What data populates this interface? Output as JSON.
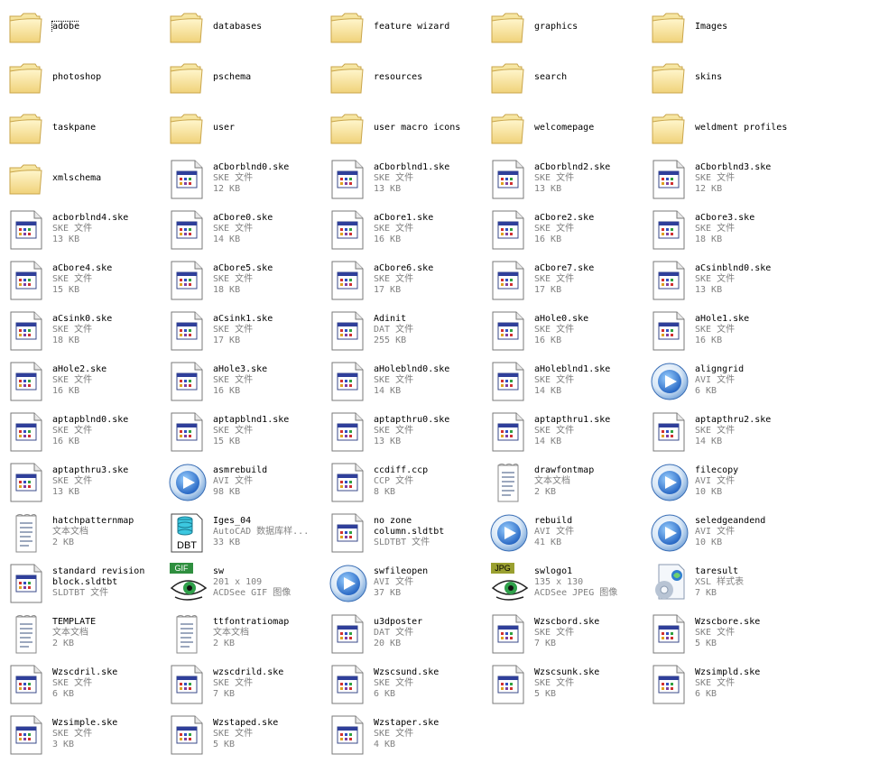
{
  "items": [
    {
      "name": "adobe",
      "icon": "folder-icon",
      "lines": [],
      "selected": true
    },
    {
      "name": "databases",
      "icon": "folder-icon",
      "lines": []
    },
    {
      "name": "feature wizard",
      "icon": "folder-icon",
      "lines": []
    },
    {
      "name": "graphics",
      "icon": "folder-icon",
      "lines": []
    },
    {
      "name": "Images",
      "icon": "folder-icon",
      "lines": []
    },
    {
      "name": "photoshop",
      "icon": "folder-icon",
      "lines": []
    },
    {
      "name": "pschema",
      "icon": "folder-icon",
      "lines": []
    },
    {
      "name": "resources",
      "icon": "folder-icon",
      "lines": []
    },
    {
      "name": "search",
      "icon": "folder-icon",
      "lines": []
    },
    {
      "name": "skins",
      "icon": "folder-icon",
      "lines": []
    },
    {
      "name": "taskpane",
      "icon": "folder-icon",
      "lines": []
    },
    {
      "name": "user",
      "icon": "folder-icon",
      "lines": []
    },
    {
      "name": "user macro icons",
      "icon": "folder-icon",
      "lines": []
    },
    {
      "name": "welcomepage",
      "icon": "folder-icon",
      "lines": []
    },
    {
      "name": "weldment profiles",
      "icon": "folder-icon",
      "lines": []
    },
    {
      "name": "xmlschema",
      "icon": "folder-icon",
      "lines": []
    },
    {
      "name": "aCborblnd0.ske",
      "icon": "ske-file-icon",
      "lines": [
        "SKE 文件",
        "12 KB"
      ]
    },
    {
      "name": "aCborblnd1.ske",
      "icon": "ske-file-icon",
      "lines": [
        "SKE 文件",
        "13 KB"
      ]
    },
    {
      "name": "aCborblnd2.ske",
      "icon": "ske-file-icon",
      "lines": [
        "SKE 文件",
        "13 KB"
      ]
    },
    {
      "name": "aCborblnd3.ske",
      "icon": "ske-file-icon",
      "lines": [
        "SKE 文件",
        "12 KB"
      ]
    },
    {
      "name": "acborblnd4.ske",
      "icon": "ske-file-icon",
      "lines": [
        "SKE 文件",
        "13 KB"
      ]
    },
    {
      "name": "aCbore0.ske",
      "icon": "ske-file-icon",
      "lines": [
        "SKE 文件",
        "14 KB"
      ]
    },
    {
      "name": "aCbore1.ske",
      "icon": "ske-file-icon",
      "lines": [
        "SKE 文件",
        "16 KB"
      ]
    },
    {
      "name": "aCbore2.ske",
      "icon": "ske-file-icon",
      "lines": [
        "SKE 文件",
        "16 KB"
      ]
    },
    {
      "name": "aCbore3.ske",
      "icon": "ske-file-icon",
      "lines": [
        "SKE 文件",
        "18 KB"
      ]
    },
    {
      "name": "aCbore4.ske",
      "icon": "ske-file-icon",
      "lines": [
        "SKE 文件",
        "15 KB"
      ]
    },
    {
      "name": "aCbore5.ske",
      "icon": "ske-file-icon",
      "lines": [
        "SKE 文件",
        "18 KB"
      ]
    },
    {
      "name": "aCbore6.ske",
      "icon": "ske-file-icon",
      "lines": [
        "SKE 文件",
        "17 KB"
      ]
    },
    {
      "name": "aCbore7.ske",
      "icon": "ske-file-icon",
      "lines": [
        "SKE 文件",
        "17 KB"
      ]
    },
    {
      "name": "aCsinblnd0.ske",
      "icon": "ske-file-icon",
      "lines": [
        "SKE 文件",
        "13 KB"
      ]
    },
    {
      "name": "aCsink0.ske",
      "icon": "ske-file-icon",
      "lines": [
        "SKE 文件",
        "18 KB"
      ]
    },
    {
      "name": "aCsink1.ske",
      "icon": "ske-file-icon",
      "lines": [
        "SKE 文件",
        "17 KB"
      ]
    },
    {
      "name": "Adinit",
      "icon": "ske-file-icon",
      "lines": [
        "DAT 文件",
        "255 KB"
      ]
    },
    {
      "name": "aHole0.ske",
      "icon": "ske-file-icon",
      "lines": [
        "SKE 文件",
        "16 KB"
      ]
    },
    {
      "name": "aHole1.ske",
      "icon": "ske-file-icon",
      "lines": [
        "SKE 文件",
        "16 KB"
      ]
    },
    {
      "name": "aHole2.ske",
      "icon": "ske-file-icon",
      "lines": [
        "SKE 文件",
        "16 KB"
      ]
    },
    {
      "name": "aHole3.ske",
      "icon": "ske-file-icon",
      "lines": [
        "SKE 文件",
        "16 KB"
      ]
    },
    {
      "name": "aHoleblnd0.ske",
      "icon": "ske-file-icon",
      "lines": [
        "SKE 文件",
        "14 KB"
      ]
    },
    {
      "name": "aHoleblnd1.ske",
      "icon": "ske-file-icon",
      "lines": [
        "SKE 文件",
        "14 KB"
      ]
    },
    {
      "name": "aligngrid",
      "icon": "media-player-icon",
      "lines": [
        "AVI 文件",
        "6 KB"
      ]
    },
    {
      "name": "aptapblnd0.ske",
      "icon": "ske-file-icon",
      "lines": [
        "SKE 文件",
        "16 KB"
      ]
    },
    {
      "name": "aptapblnd1.ske",
      "icon": "ske-file-icon",
      "lines": [
        "SKE 文件",
        "15 KB"
      ]
    },
    {
      "name": "aptapthru0.ske",
      "icon": "ske-file-icon",
      "lines": [
        "SKE 文件",
        "13 KB"
      ]
    },
    {
      "name": "aptapthru1.ske",
      "icon": "ske-file-icon",
      "lines": [
        "SKE 文件",
        "14 KB"
      ]
    },
    {
      "name": "aptapthru2.ske",
      "icon": "ske-file-icon",
      "lines": [
        "SKE 文件",
        "14 KB"
      ]
    },
    {
      "name": "aptapthru3.ske",
      "icon": "ske-file-icon",
      "lines": [
        "SKE 文件",
        "13 KB"
      ]
    },
    {
      "name": "asmrebuild",
      "icon": "media-player-icon",
      "lines": [
        "AVI 文件",
        "98 KB"
      ]
    },
    {
      "name": "ccdiff.ccp",
      "icon": "ske-file-icon",
      "lines": [
        "CCP 文件",
        "8 KB"
      ]
    },
    {
      "name": "drawfontmap",
      "icon": "text-doc-icon",
      "lines": [
        "文本文档",
        "2 KB"
      ]
    },
    {
      "name": "filecopy",
      "icon": "media-player-icon",
      "lines": [
        "AVI 文件",
        "10 KB"
      ]
    },
    {
      "name": "hatchpatternmap",
      "icon": "text-doc-icon",
      "lines": [
        "文本文档",
        "2 KB"
      ]
    },
    {
      "name": "Iges_04",
      "icon": "dbt-database-icon",
      "lines": [
        "AutoCAD 数据库样...",
        "33 KB"
      ]
    },
    {
      "name": "no zone",
      "icon": "ske-file-icon",
      "lines": [
        "column.sldtbt",
        "SLDTBT 文件"
      ]
    },
    {
      "name": "rebuild",
      "icon": "media-player-icon",
      "lines": [
        "AVI 文件",
        "41 KB"
      ]
    },
    {
      "name": "seledgeandend",
      "icon": "media-player-icon",
      "lines": [
        "AVI 文件",
        "10 KB"
      ]
    },
    {
      "name": "standard revision",
      "icon": "ske-file-icon",
      "lines": [
        "block.sldtbt",
        "SLDTBT 文件"
      ]
    },
    {
      "name": "sw",
      "icon": "gif-image-icon",
      "lines": [
        "201 x 109",
        "ACDSee GIF 图像"
      ]
    },
    {
      "name": "swfileopen",
      "icon": "media-player-icon",
      "lines": [
        "AVI 文件",
        "37 KB"
      ]
    },
    {
      "name": "swlogo1",
      "icon": "jpg-image-icon",
      "lines": [
        "135 x 130",
        "ACDSee JPEG 图像"
      ]
    },
    {
      "name": "taresult",
      "icon": "xsl-stylesheet-icon",
      "lines": [
        "XSL 样式表",
        "7 KB"
      ]
    },
    {
      "name": "TEMPLATE",
      "icon": "text-doc-icon",
      "lines": [
        "文本文档",
        "2 KB"
      ]
    },
    {
      "name": "ttfontratiomap",
      "icon": "text-doc-icon",
      "lines": [
        "文本文档",
        "2 KB"
      ]
    },
    {
      "name": "u3dposter",
      "icon": "ske-file-icon",
      "lines": [
        "DAT 文件",
        "20 KB"
      ]
    },
    {
      "name": "Wzscbord.ske",
      "icon": "ske-file-icon",
      "lines": [
        "SKE 文件",
        "7 KB"
      ]
    },
    {
      "name": "Wzscbore.ske",
      "icon": "ske-file-icon",
      "lines": [
        "SKE 文件",
        "5 KB"
      ]
    },
    {
      "name": "Wzscdril.ske",
      "icon": "ske-file-icon",
      "lines": [
        "SKE 文件",
        "6 KB"
      ]
    },
    {
      "name": "wzscdrild.ske",
      "icon": "ske-file-icon",
      "lines": [
        "SKE 文件",
        "7 KB"
      ]
    },
    {
      "name": "Wzscsund.ske",
      "icon": "ske-file-icon",
      "lines": [
        "SKE 文件",
        "6 KB"
      ]
    },
    {
      "name": "Wzscsunk.ske",
      "icon": "ske-file-icon",
      "lines": [
        "SKE 文件",
        "5 KB"
      ]
    },
    {
      "name": "Wzsimpld.ske",
      "icon": "ske-file-icon",
      "lines": [
        "SKE 文件",
        "6 KB"
      ]
    },
    {
      "name": "Wzsimple.ske",
      "icon": "ske-file-icon",
      "lines": [
        "SKE 文件",
        "3 KB"
      ]
    },
    {
      "name": "Wzstaped.ske",
      "icon": "ske-file-icon",
      "lines": [
        "SKE 文件",
        "5 KB"
      ]
    },
    {
      "name": "Wzstaper.ske",
      "icon": "ske-file-icon",
      "lines": [
        "SKE 文件",
        "4 KB"
      ]
    }
  ]
}
